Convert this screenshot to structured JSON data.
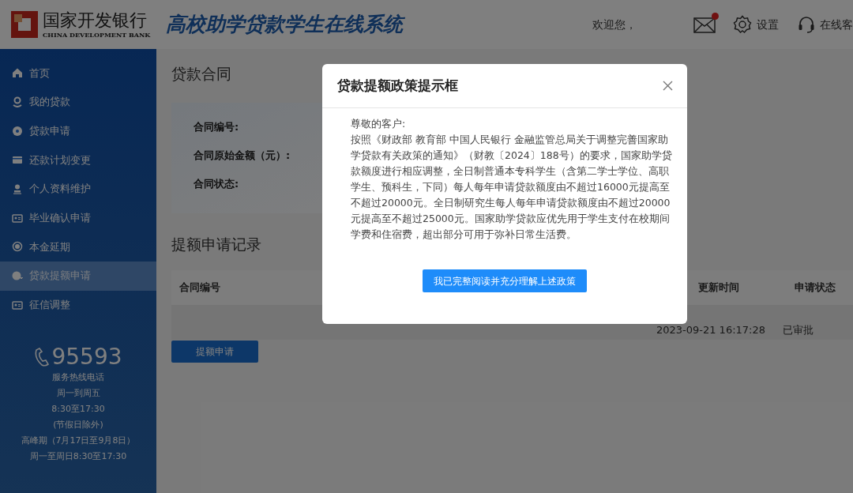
{
  "header": {
    "bank_name": "国家开发银行",
    "bank_name_en": "CHINA DEVELOPMENT BANK",
    "system_title": "高校助学贷款学生在线系统",
    "welcome": "欢迎您，",
    "mail_unread": true,
    "settings": "设置",
    "online_service": "在线客"
  },
  "sidebar": {
    "items": [
      {
        "label": "首页",
        "kind": "home",
        "selected": false
      },
      {
        "label": "我的贷款",
        "kind": "user",
        "selected": false
      },
      {
        "label": "贷款申请",
        "kind": "apply",
        "selected": false
      },
      {
        "label": "还款计划变更",
        "kind": "plan",
        "selected": false
      },
      {
        "label": "个人资料维护",
        "kind": "profile",
        "selected": false
      },
      {
        "label": "毕业确认申请",
        "kind": "card",
        "selected": false
      },
      {
        "label": "本金延期",
        "kind": "defer",
        "selected": false
      },
      {
        "label": "贷款提额申请",
        "kind": "raise",
        "selected": true
      },
      {
        "label": "征信调整",
        "kind": "card",
        "selected": false
      }
    ],
    "hotline": "95593",
    "hotline_lines": [
      "服务热线电话",
      "周一到周五",
      "8:30至17:30",
      "(节假日除外)",
      "高峰期（7月17日至9月8日）",
      "周一至周日8:30至17:30"
    ]
  },
  "contract": {
    "title": "贷款合同",
    "fields": [
      "合同编号:",
      "合同原始金额（元）:",
      "合同状态:"
    ]
  },
  "records": {
    "title": "提额申请记录",
    "columns": [
      "合同编号",
      "更新时间",
      "申请状态"
    ],
    "rows": [
      {
        "updated": "2023-09-21 16:17:28",
        "status": "已审批"
      }
    ],
    "button": "提额申请"
  },
  "dialog": {
    "title": "贷款提额政策提示框",
    "greeting": "尊敬的客户:",
    "body": "按照《财政部 教育部 中国人民银行 金融监管总局关于调整完善国家助学贷款有关政策的通知》（财教〔2024〕188号）的要求，国家助学贷款额度进行相应调整，全日制普通本专科学生（含第二学士学位、高职学生、预科生，下同）每人每年申请贷款额度由不超过16000元提高至不超过20000元。全日制研究生每人每年申请贷款额度由不超过20000元提高至不超过25000元。国家助学贷款应优先用于学生支付在校期间学费和住宿费，超出部分可用于弥补日常生活费。",
    "confirm": "我已完整阅读并充分理解上述政策"
  }
}
